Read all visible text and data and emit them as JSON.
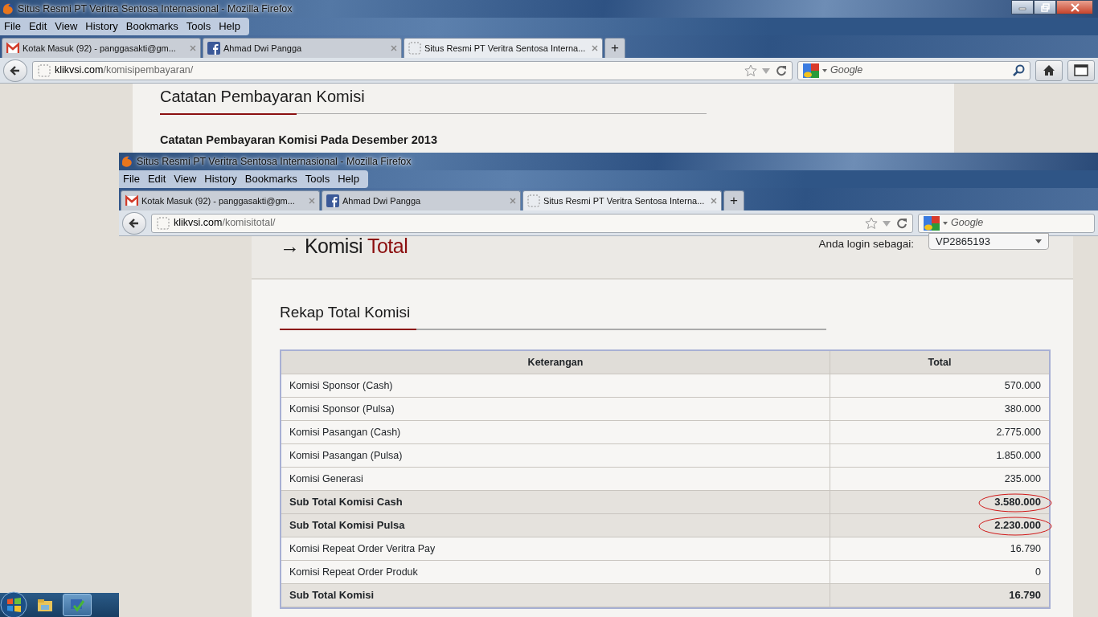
{
  "back_window": {
    "title": "Situs Resmi PT Veritra Sentosa Internasional - Mozilla Firefox",
    "window_controls": true,
    "menu": [
      "File",
      "Edit",
      "View",
      "History",
      "Bookmarks",
      "Tools",
      "Help"
    ],
    "tabs": [
      {
        "label": "Kotak Masuk (92) - panggasakti@gm...",
        "kind": "mail",
        "selected": false
      },
      {
        "label": "Ahmad Dwi Pangga",
        "kind": "facebook",
        "selected": false
      },
      {
        "label": "Situs Resmi PT Veritra Sentosa Interna...",
        "kind": "blank",
        "selected": true
      }
    ],
    "new_tab": "+",
    "address": {
      "domain": "klikvsi.com",
      "path": "/komisipembayaran/"
    },
    "search": {
      "placeholder": "Google"
    },
    "toolbar_buttons": [
      {
        "kind": "home"
      },
      {
        "kind": "tab_groups"
      }
    ],
    "page": {
      "heading": "Catatan Pembayaran Komisi",
      "subheading": "Catatan Pembayaran Komisi Pada Desember 2013"
    }
  },
  "front_window": {
    "title": "Situs Resmi PT Veritra Sentosa Internasional - Mozilla Firefox",
    "window_controls": false,
    "menu": [
      "File",
      "Edit",
      "View",
      "History",
      "Bookmarks",
      "Tools",
      "Help"
    ],
    "tabs": [
      {
        "label": "Kotak Masuk (92) - panggasakti@gm...",
        "kind": "mail",
        "selected": false
      },
      {
        "label": "Ahmad Dwi Pangga",
        "kind": "facebook",
        "selected": false
      },
      {
        "label": "Situs Resmi PT Veritra Sentosa Interna...",
        "kind": "blank",
        "selected": true
      }
    ],
    "new_tab": "+",
    "address": {
      "domain": "klikvsi.com",
      "path": "/komisitotal/"
    },
    "search": {
      "placeholder": "Google"
    },
    "page": {
      "arrow": "→",
      "title": "Komisi",
      "title_accent": "Total",
      "login_label": "Anda login sebagai:",
      "login_value": "VP2865193",
      "section_title": "Rekap Total Komisi",
      "columns": [
        "Keterangan",
        "Total"
      ],
      "rows": [
        {
          "label": "Komisi Sponsor (Cash)",
          "total": "570.000",
          "kind": "item",
          "circled": false
        },
        {
          "label": "Komisi Sponsor (Pulsa)",
          "total": "380.000",
          "kind": "item",
          "circled": false
        },
        {
          "label": "Komisi Pasangan (Cash)",
          "total": "2.775.000",
          "kind": "item",
          "circled": false
        },
        {
          "label": "Komisi Pasangan (Pulsa)",
          "total": "1.850.000",
          "kind": "item",
          "circled": false
        },
        {
          "label": "Komisi Generasi",
          "total": "235.000",
          "kind": "item",
          "circled": false
        },
        {
          "label": "Sub Total Komisi Cash",
          "total": "3.580.000",
          "kind": "subtotal",
          "circled": true
        },
        {
          "label": "Sub Total Komisi Pulsa",
          "total": "2.230.000",
          "kind": "subtotal",
          "circled": true
        },
        {
          "label": "Komisi Repeat Order Veritra Pay",
          "total": "16.790",
          "kind": "item",
          "circled": false
        },
        {
          "label": "Komisi Repeat Order Produk",
          "total": "0",
          "kind": "item",
          "circled": false
        },
        {
          "label": "Sub Total Komisi",
          "total": "16.790",
          "kind": "subtotal",
          "circled": false
        }
      ]
    }
  },
  "taskbar": {
    "items": [
      {
        "kind": "explorer",
        "selected": false
      },
      {
        "kind": "app",
        "selected": true
      }
    ]
  }
}
